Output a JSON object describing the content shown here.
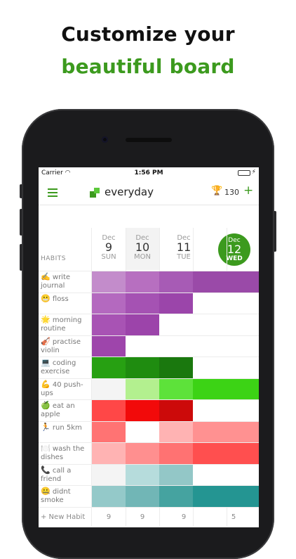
{
  "headline": {
    "line1": "Customize your",
    "line2": "beautiful board"
  },
  "status": {
    "carrier": "Carrier",
    "time": "1:56 PM"
  },
  "app": {
    "brand": "everyday",
    "score": "130"
  },
  "header": {
    "habits_label": "HABITS"
  },
  "days": [
    {
      "month": "Dec",
      "day": "9",
      "weekday": "SUN"
    },
    {
      "month": "Dec",
      "day": "10",
      "weekday": "MON"
    },
    {
      "month": "Dec",
      "day": "11",
      "weekday": "TUE"
    },
    {
      "month": "Dec",
      "day": "12",
      "weekday": "WED"
    }
  ],
  "habits": [
    {
      "icon": "✍️",
      "icon_name": "writing-hand-icon",
      "name": "write journal",
      "cells": [
        "#c38ccb",
        "#b76fc0",
        "#a75bb5",
        "#9a4aa8",
        "#9a4aa8"
      ]
    },
    {
      "icon": "😬",
      "icon_name": "grimace-icon",
      "name": "floss",
      "cells": [
        "#b469bf",
        "#a552b3",
        "#9b45aa",
        "#ffffff",
        "#ffffff"
      ]
    },
    {
      "icon": "🌟",
      "icon_name": "sun-icon",
      "name": "morning routine",
      "cells": [
        "#a853b4",
        "#9c44aa",
        "#ffffff",
        "#ffffff",
        "#ffffff"
      ]
    },
    {
      "icon": "🎻",
      "icon_name": "violin-icon",
      "name": "practise violin",
      "cells": [
        "#9e45ab",
        "#ffffff",
        "#ffffff",
        "#ffffff",
        "#ffffff"
      ]
    },
    {
      "icon": "💻",
      "icon_name": "laptop-icon",
      "name": "coding exercise",
      "cells": [
        "#27a012",
        "#1f8c10",
        "#1a780e",
        "#ffffff",
        "#ffffff"
      ]
    },
    {
      "icon": "💪",
      "icon_name": "biceps-icon",
      "name": "40 push-ups",
      "cells": [
        "#f4f4f4",
        "#b3f08f",
        "#5de23a",
        "#3cd315",
        "#3cd315"
      ]
    },
    {
      "icon": "🍏",
      "icon_name": "apple-icon",
      "name": "eat an apple",
      "cells": [
        "#ff4747",
        "#f20a0a",
        "#cc0a0a",
        "#ffffff",
        "#ffffff"
      ]
    },
    {
      "icon": "🏃",
      "icon_name": "runner-icon",
      "name": "run 5km",
      "cells": [
        "#ff7373",
        "#ffffff",
        "#ffb3b3",
        "#ff9191",
        "#ff9191"
      ]
    },
    {
      "icon": "🍽️",
      "icon_name": "plate-icon",
      "name": "wash the dishes",
      "cells": [
        "#ffb3b3",
        "#ff8f8f",
        "#ff7272",
        "#ff4f4f",
        "#ff4f4f"
      ]
    },
    {
      "icon": "📞",
      "icon_name": "phone-icon",
      "name": "call a friend",
      "cells": [
        "#f4f4f4",
        "#b6dcdc",
        "#93c7c7",
        "#ffffff",
        "#ffffff"
      ]
    },
    {
      "icon": "🤐",
      "icon_name": "no-smoke-icon",
      "name": "didnt smoke",
      "cells": [
        "#94c9c9",
        "#71b6b6",
        "#45a3a0",
        "#249592",
        "#249592"
      ]
    }
  ],
  "footer": {
    "new_habit": "+ New Habit",
    "counts": [
      "9",
      "9",
      "9",
      "5"
    ]
  }
}
